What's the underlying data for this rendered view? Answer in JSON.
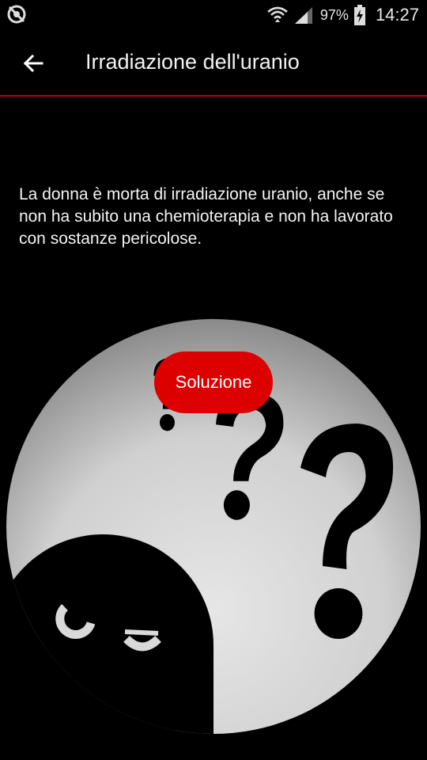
{
  "status_bar": {
    "battery": "97%",
    "time": "14:27",
    "icons": [
      "app-notification-icon",
      "wifi-icon",
      "signal-icon",
      "battery-charging-icon"
    ]
  },
  "app_bar": {
    "back_icon": "arrow-left-icon",
    "title": "Irradiazione dell'uranio"
  },
  "riddle": {
    "text": "La donna è morta di irradiazione uranio, anche se non ha subito una chemioterapia e non ha lavorato con sostanze pericolose."
  },
  "actions": {
    "solution_label": "Soluzione"
  },
  "colors": {
    "accent": "#dd0000",
    "divider": "#c40000",
    "background": "#000000"
  }
}
